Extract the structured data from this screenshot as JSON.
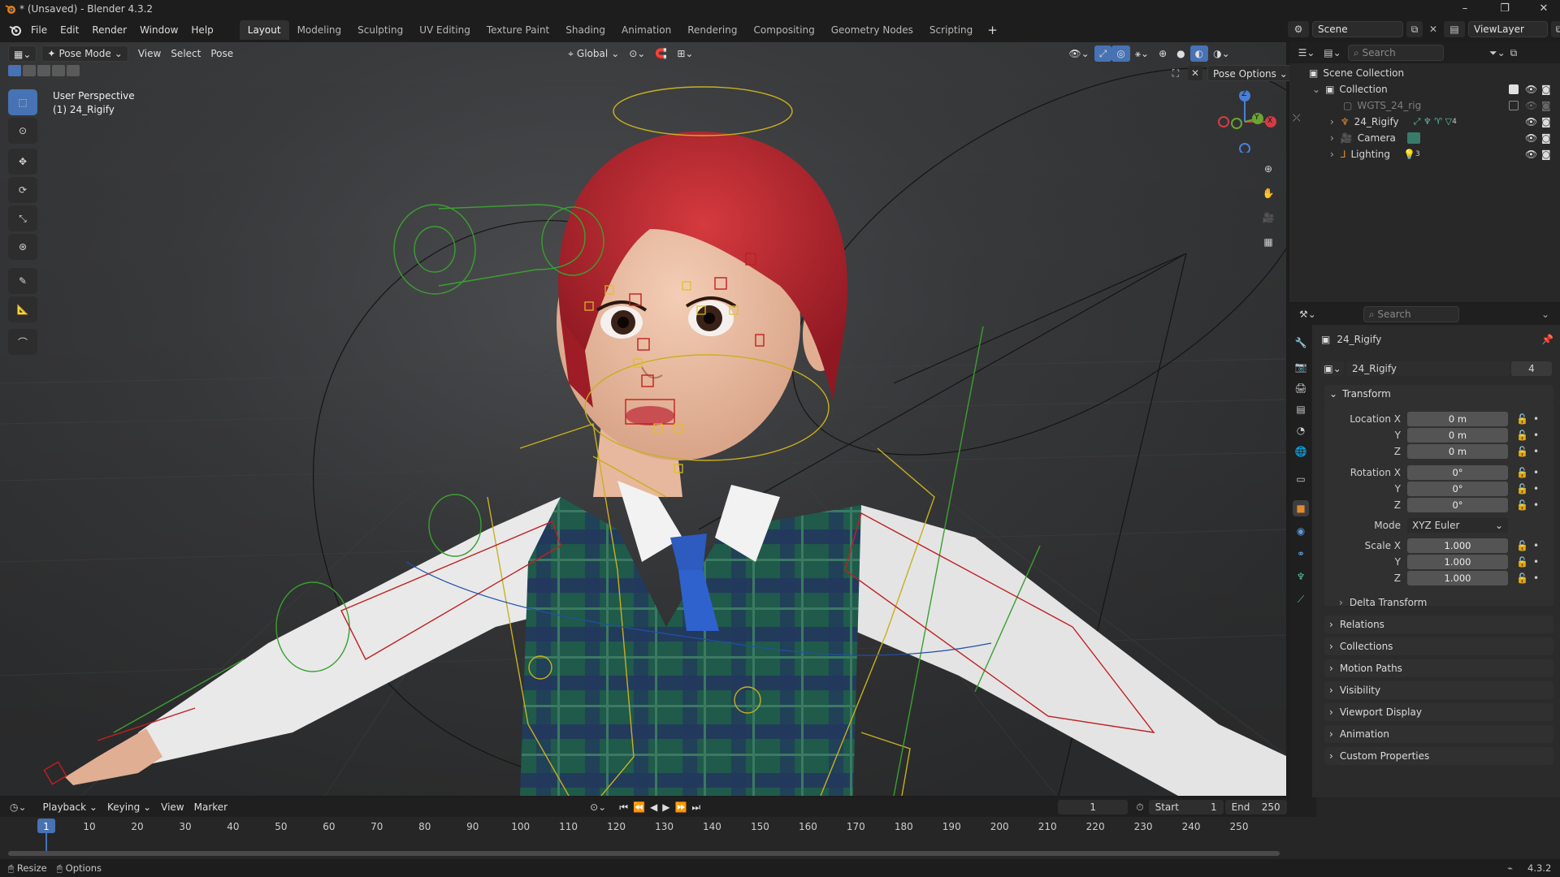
{
  "window": {
    "title": "* (Unsaved) - Blender 4.3.2",
    "version": "4.3.2"
  },
  "menus": [
    "File",
    "Edit",
    "Render",
    "Window",
    "Help"
  ],
  "workspaces": [
    "Layout",
    "Modeling",
    "Sculpting",
    "UV Editing",
    "Texture Paint",
    "Shading",
    "Animation",
    "Rendering",
    "Compositing",
    "Geometry Nodes",
    "Scripting"
  ],
  "active_workspace": "Layout",
  "scene": {
    "label": "Scene",
    "view_layer": "ViewLayer"
  },
  "viewport": {
    "mode": "Pose Mode",
    "header_menus": [
      "View",
      "Select",
      "Pose"
    ],
    "transform_orientation": "Global",
    "pose_options": "Pose Options",
    "overlay_text_1": "User Perspective",
    "overlay_text_2": "(1) 24_Rigify",
    "gizmo_axes": {
      "x": "X",
      "y": "Y",
      "z": "Z"
    }
  },
  "outliner": {
    "search_placeholder": "Search",
    "root": "Scene Collection",
    "items": [
      {
        "label": "Collection"
      },
      {
        "label": "WGTS_24_rig"
      },
      {
        "label": "24_Rigify",
        "badge": "4"
      },
      {
        "label": "Camera"
      },
      {
        "label": "Lighting",
        "badge": "3"
      }
    ]
  },
  "properties": {
    "search_placeholder": "Search",
    "object_name": "24_Rigify",
    "datablock_name": "24_Rigify",
    "datablock_users": "4",
    "transform_header": "Transform",
    "location": {
      "label": "Location X",
      "x": "0 m",
      "y": "0 m",
      "z": "0 m"
    },
    "rotation": {
      "label": "Rotation X",
      "x": "0°",
      "y": "0°",
      "z": "0°"
    },
    "axis_labels": {
      "y": "Y",
      "z": "Z"
    },
    "mode": {
      "label": "Mode",
      "value": "XYZ Euler"
    },
    "scale": {
      "label": "Scale X",
      "x": "1.000",
      "y": "1.000",
      "z": "1.000"
    },
    "sub_panel": "Delta Transform",
    "panels": [
      "Relations",
      "Collections",
      "Motion Paths",
      "Visibility",
      "Viewport Display",
      "Animation",
      "Custom Properties"
    ]
  },
  "timeline": {
    "menus": [
      "Playback",
      "Keying",
      "View",
      "Marker"
    ],
    "current_frame": "1",
    "start_label": "Start",
    "start": "1",
    "end_label": "End",
    "end": "250",
    "ticks": [
      "1",
      "10",
      "20",
      "30",
      "40",
      "50",
      "60",
      "70",
      "80",
      "90",
      "100",
      "110",
      "120",
      "130",
      "140",
      "150",
      "160",
      "170",
      "180",
      "190",
      "200",
      "210",
      "220",
      "230",
      "240",
      "250"
    ]
  },
  "statusbar": {
    "left_1": "Resize",
    "left_2": "Options",
    "version": "4.3.2"
  },
  "colors": {
    "accent": "#4772b3",
    "bone_yellow": "#c8b020",
    "bone_red": "#c02020",
    "bone_green": "#3aa030",
    "hair": "#b8202a",
    "vest": "#2a5a48"
  }
}
